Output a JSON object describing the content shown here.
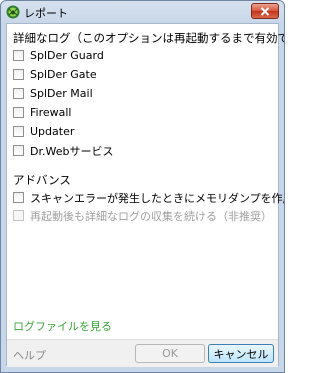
{
  "window": {
    "title": "レポート",
    "close_icon": "close-icon"
  },
  "log_section": {
    "heading": "詳細なログ（このオプションは再起動するまで有効です）",
    "items": [
      {
        "label": "SplDer Guard",
        "checked": false
      },
      {
        "label": "SplDer Gate",
        "checked": false
      },
      {
        "label": "SplDer Mail",
        "checked": false
      },
      {
        "label": "Firewall",
        "checked": false
      },
      {
        "label": "Updater",
        "checked": false
      },
      {
        "label": "Dr.Webサービス",
        "checked": false
      }
    ]
  },
  "advanced_section": {
    "heading": "アドバンス",
    "items": [
      {
        "label": "スキャンエラーが発生したときにメモリダンプを作成する",
        "checked": false,
        "enabled": true
      },
      {
        "label": "再起動後も詳細なログの収集を続ける（非推奨）",
        "checked": false,
        "enabled": false
      }
    ]
  },
  "links": {
    "log_files": "ログファイルを見る",
    "help": "ヘルプ"
  },
  "buttons": {
    "ok": "OK",
    "cancel": "キャンセル"
  },
  "colors": {
    "link_green": "#3aa63a",
    "close_red": "#c3341a"
  }
}
